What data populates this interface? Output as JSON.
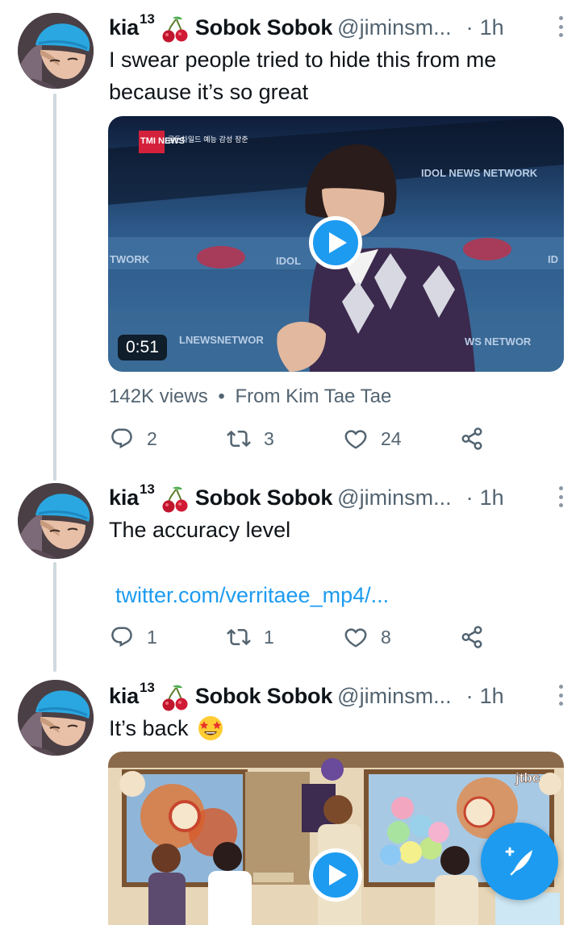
{
  "tweets": [
    {
      "display_name": "kia",
      "superscript": "13",
      "name_suffix": "Sobok Sobok",
      "handle": "@jiminsm...",
      "separator": "·",
      "time": "1h",
      "text_lines": [
        "I swear people tried to hide this from me",
        "because it’s so great"
      ],
      "media": {
        "type": "video",
        "duration": "0:51",
        "overlay_texts": [
          "TMI NEWS",
          "골든차일드 예능 감성 장준",
          "IDOL NEWS NETWORK",
          "TWORK",
          "IDOL",
          "LNEWSNETWOR",
          "WS NETWOR",
          "ID"
        ]
      },
      "views": "142K views",
      "views_separator": "•",
      "source": "From Kim Tae Tae",
      "replies": "2",
      "retweets": "3",
      "likes": "24"
    },
    {
      "display_name": "kia",
      "superscript": "13",
      "name_suffix": "Sobok Sobok",
      "handle": "@jiminsm...",
      "separator": "·",
      "time": "1h",
      "text_lines": [
        "The accuracy level"
      ],
      "link": "twitter.com/verritaee_mp4/...",
      "replies": "1",
      "retweets": "1",
      "likes": "8"
    },
    {
      "display_name": "kia",
      "superscript": "13",
      "name_suffix": "Sobok Sobok",
      "handle": "@jiminsm...",
      "separator": "·",
      "time": "1h",
      "text": "It’s back",
      "media": {
        "type": "video",
        "overlay_texts": [
          "jtbc"
        ]
      }
    }
  ],
  "icons": {
    "emoji": "star-struck-emoji",
    "name_emoji": "cherries-emoji",
    "reply": "reply-icon",
    "retweet": "retweet-icon",
    "like": "heart-icon",
    "share": "share-icon",
    "compose": "compose-tweet-icon"
  },
  "colors": {
    "accent": "#1d9bf0",
    "text_primary": "#0f1419",
    "text_secondary": "#536471",
    "thread_line": "#cfd9de"
  }
}
